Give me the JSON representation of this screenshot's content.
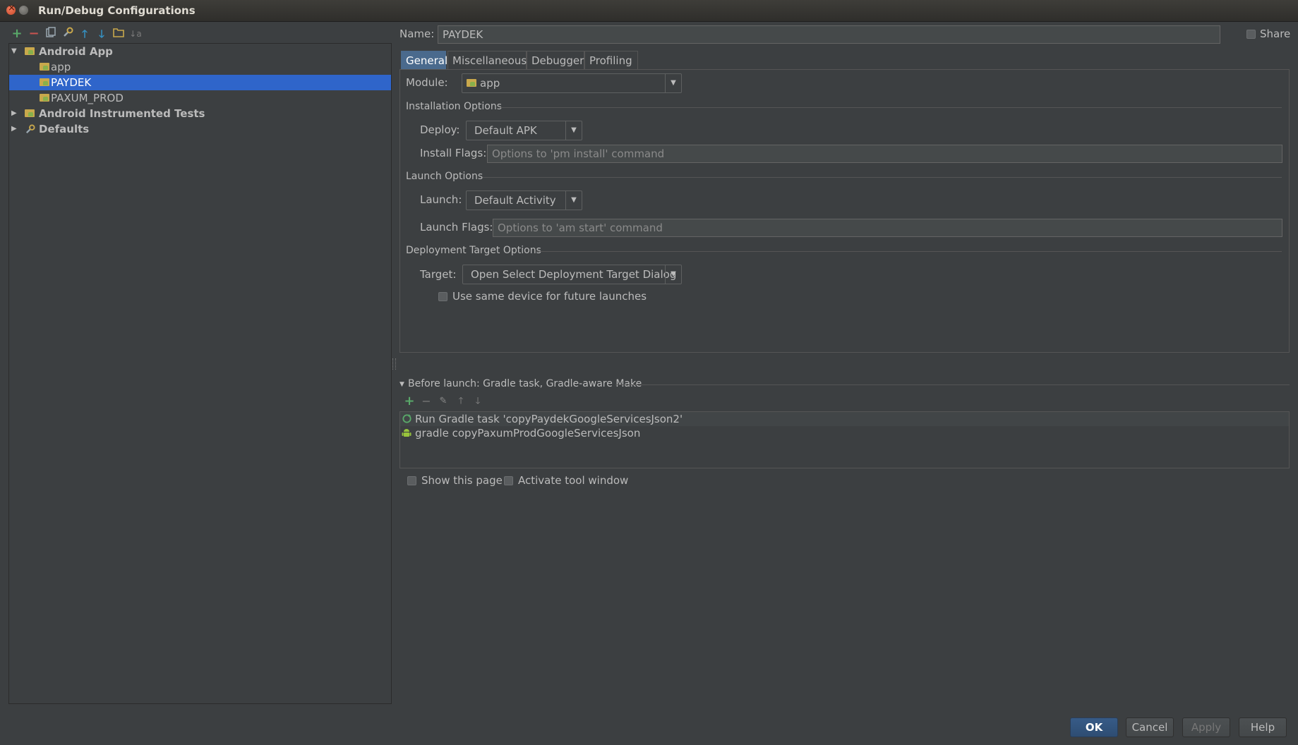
{
  "window": {
    "title": "Run/Debug Configurations"
  },
  "left_toolbar": {
    "icons": [
      "add-icon",
      "remove-icon",
      "copy-icon",
      "wrench-icon",
      "move-up-icon",
      "move-down-icon",
      "folder-icon",
      "sort-icon"
    ]
  },
  "tree": {
    "items": [
      {
        "label": "Android App",
        "bold": true,
        "expanded": true,
        "level": 0
      },
      {
        "label": "app",
        "level": 1
      },
      {
        "label": "PAYDEK",
        "level": 1,
        "selected": true
      },
      {
        "label": "PAXUM_PROD",
        "level": 1
      },
      {
        "label": "Android Instrumented Tests",
        "bold": true,
        "expanded": false,
        "level": 0
      },
      {
        "label": "Defaults",
        "bold": true,
        "expanded": false,
        "level": 0
      }
    ]
  },
  "name": {
    "label": "Name:",
    "value": "PAYDEK"
  },
  "share": {
    "label": "Share",
    "checked": false
  },
  "tabs": [
    {
      "label": "General",
      "active": true
    },
    {
      "label": "Miscellaneous"
    },
    {
      "label": "Debugger"
    },
    {
      "label": "Profiling"
    }
  ],
  "general": {
    "module": {
      "label": "Module:",
      "value": "app"
    },
    "installation": {
      "title": "Installation Options",
      "deploy": {
        "label": "Deploy:",
        "value": "Default APK"
      },
      "install_flags": {
        "label": "Install Flags:",
        "placeholder": "Options to 'pm install' command"
      }
    },
    "launch": {
      "title": "Launch Options",
      "launch": {
        "label": "Launch:",
        "value": "Default Activity"
      },
      "launch_flags": {
        "label": "Launch Flags:",
        "placeholder": "Options to 'am start' command"
      }
    },
    "deployment_target": {
      "title": "Deployment Target Options",
      "target": {
        "label": "Target:",
        "value": "Open Select Deployment Target Dialog"
      },
      "same_device": {
        "label": "Use same device for future launches",
        "checked": false
      }
    }
  },
  "before_launch": {
    "title": "Before launch: Gradle task, Gradle-aware Make",
    "toolbar_icons": [
      "add-icon",
      "remove-icon",
      "edit-icon",
      "move-up-icon",
      "move-down-icon"
    ],
    "items": [
      {
        "label": "Run Gradle task 'copyPaydekGoogleServicesJson2'",
        "icon": "gradle-refresh-icon"
      },
      {
        "label": "gradle copyPaxumProdGoogleServicesJson",
        "icon": "android-icon"
      }
    ]
  },
  "options": {
    "show_page": {
      "label": "Show this page",
      "checked": false
    },
    "activate_tool_window": {
      "label": "Activate tool window",
      "checked": false
    }
  },
  "buttons": {
    "ok": "OK",
    "cancel": "Cancel",
    "apply": "Apply",
    "help": "Help"
  },
  "colors": {
    "background": "#3c3f41",
    "selection": "#2f65ca",
    "active_tab": "#4a6a8d",
    "add_green": "#59a869",
    "remove_red": "#c75450",
    "arrow_blue": "#3592c4"
  }
}
